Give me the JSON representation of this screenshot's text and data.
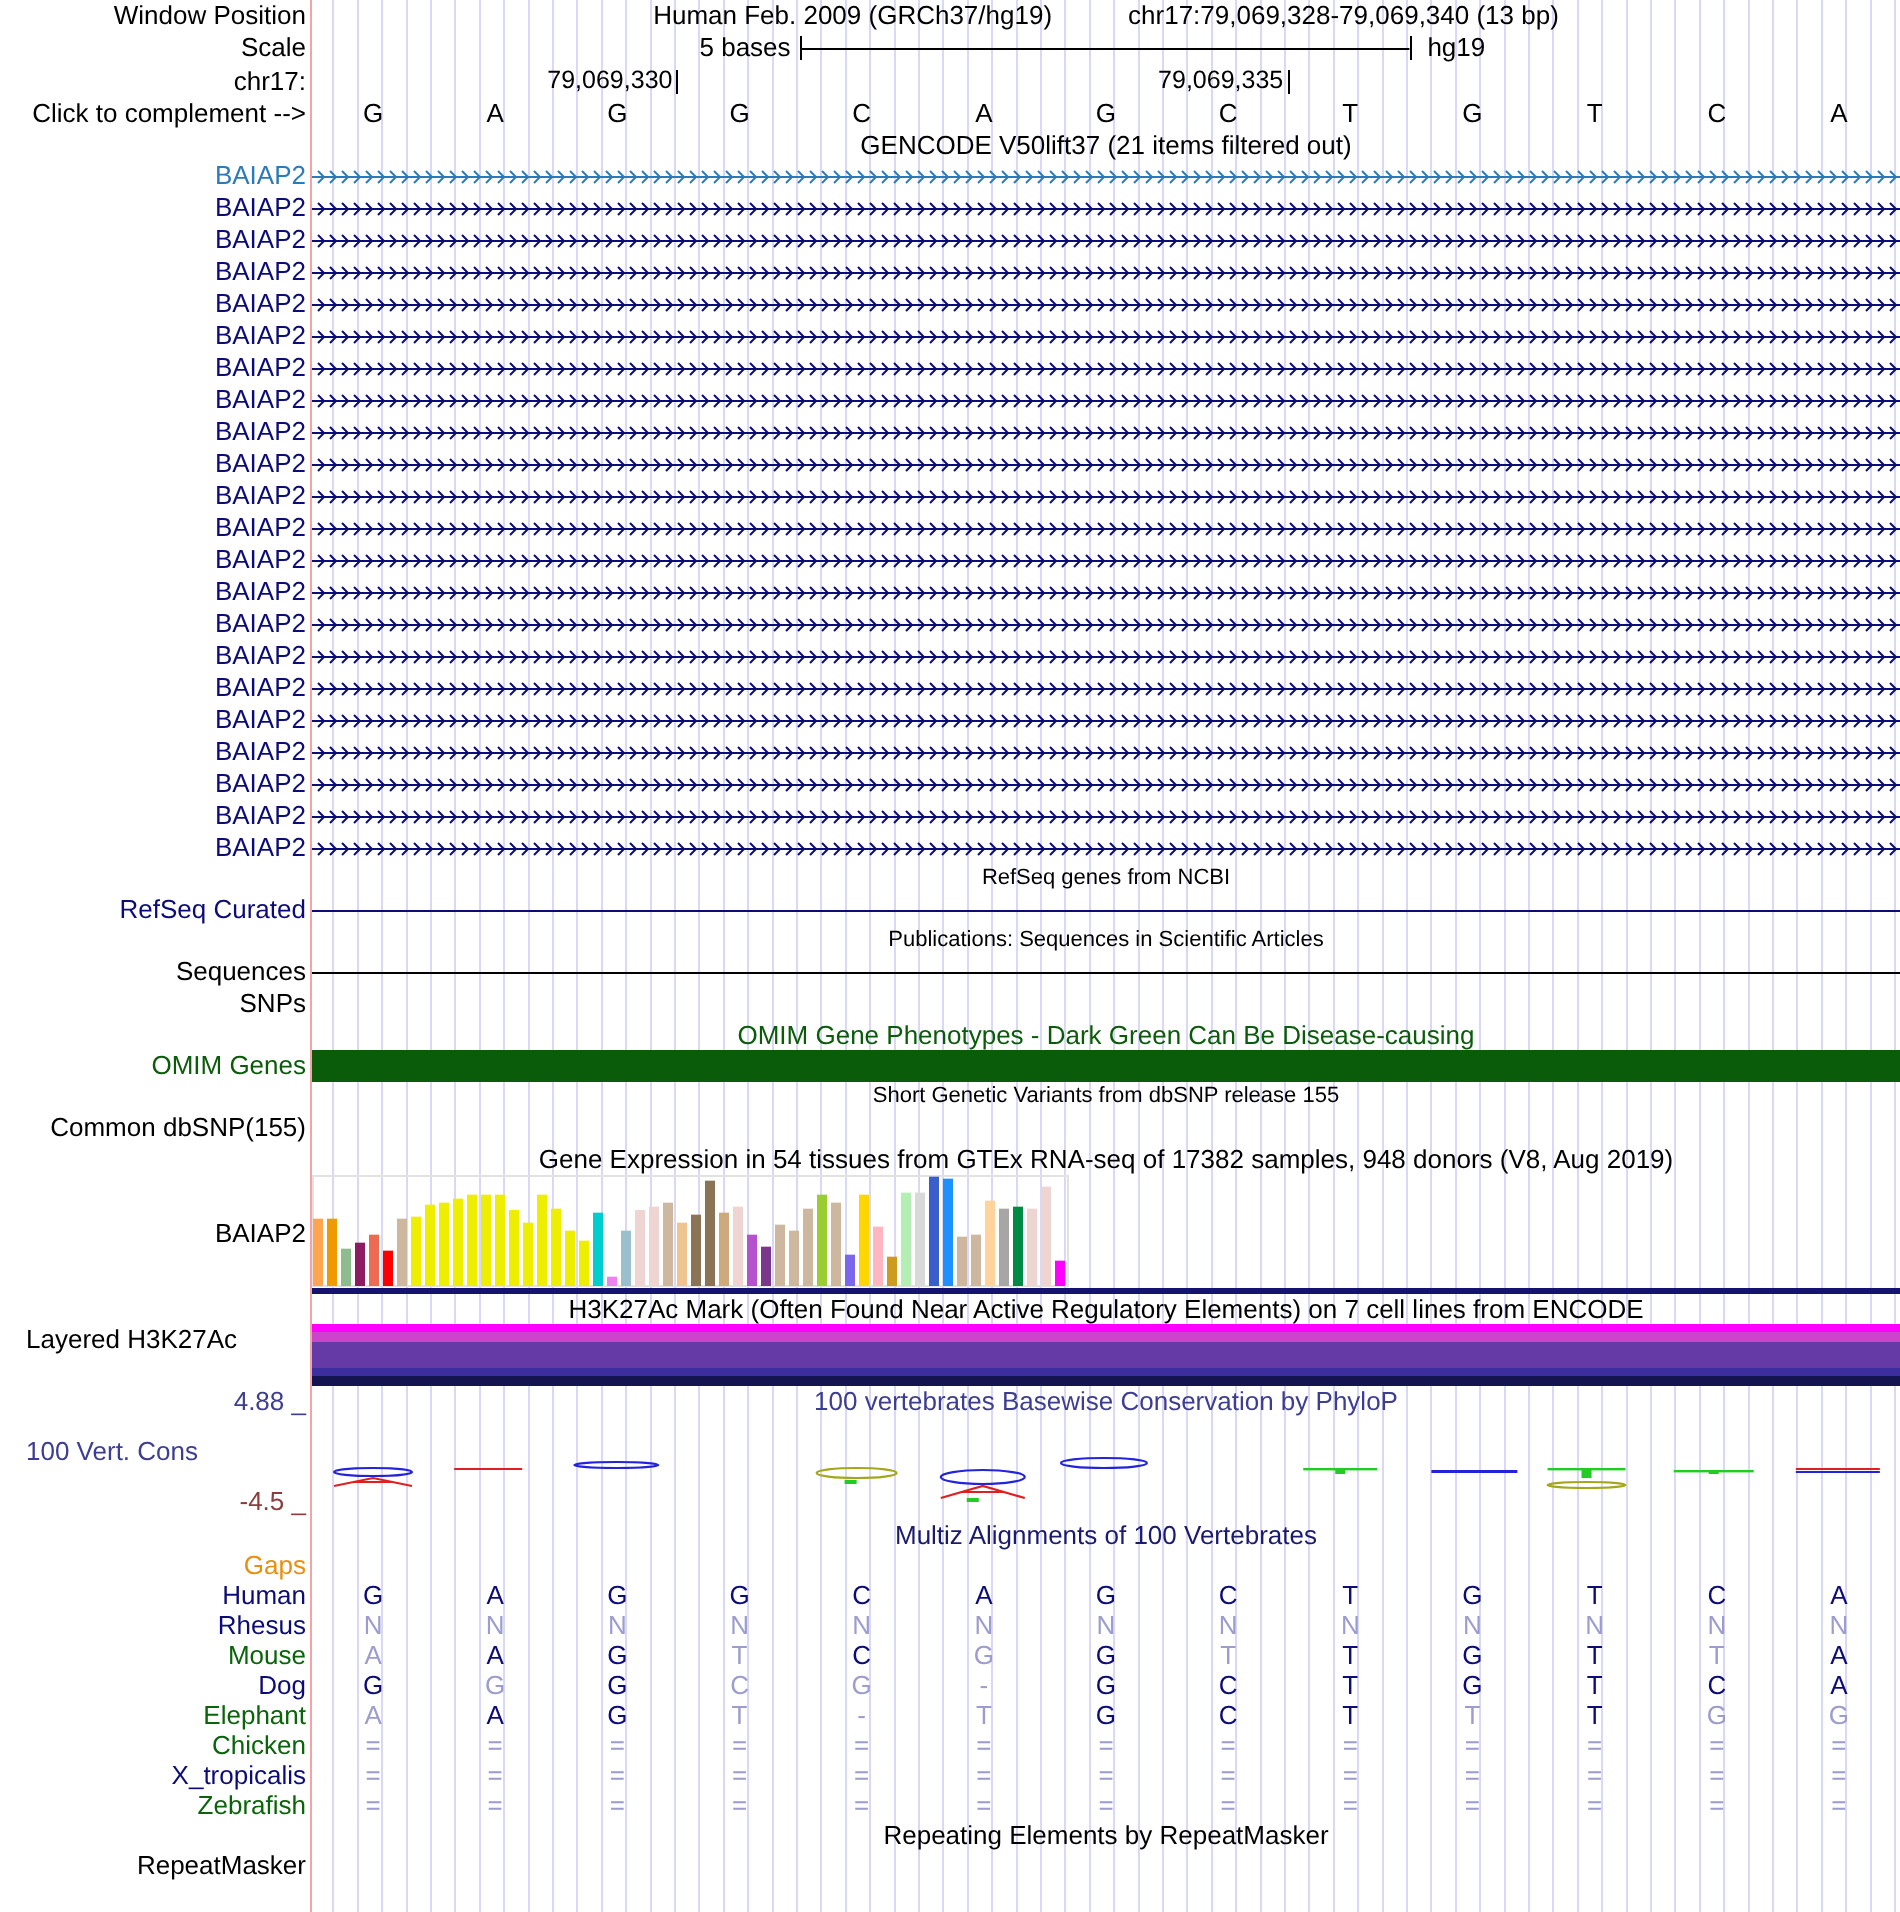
{
  "header": {
    "position": {
      "label": "Window Position",
      "assembly": "Human Feb. 2009 (GRCh37/hg19)",
      "range": "chr17:79,069,328-79,069,340 (13 bp)"
    },
    "scale": {
      "label": "Scale",
      "length": "5 bases",
      "assembly": "hg19"
    },
    "ruler": {
      "label": "chr17:",
      "ticks": [
        "79,069,330",
        "79,069,335"
      ]
    },
    "sequence": {
      "label": "Click to complement -->",
      "bases": [
        "G",
        "A",
        "G",
        "G",
        "C",
        "A",
        "G",
        "C",
        "T",
        "G",
        "T",
        "C",
        "A"
      ]
    }
  },
  "tracks": [
    {
      "dense": false,
      "title": "GENCODE V50lift37 (21 items filtered out)",
      "color": "#000000",
      "rows": [
        {
          "kind": "gene",
          "label": "BAIAP2",
          "color": "#2b7bba"
        },
        {
          "kind": "gene",
          "label": "BAIAP2",
          "color": "#0c0c78"
        },
        {
          "kind": "gene",
          "label": "BAIAP2",
          "color": "#0c0c78"
        },
        {
          "kind": "gene",
          "label": "BAIAP2",
          "color": "#0c0c78"
        },
        {
          "kind": "gene",
          "label": "BAIAP2",
          "color": "#0c0c78"
        },
        {
          "kind": "gene",
          "label": "BAIAP2",
          "color": "#0c0c78"
        },
        {
          "kind": "gene",
          "label": "BAIAP2",
          "color": "#0c0c78"
        },
        {
          "kind": "gene",
          "label": "BAIAP2",
          "color": "#0c0c78"
        },
        {
          "kind": "gene",
          "label": "BAIAP2",
          "color": "#0c0c78"
        },
        {
          "kind": "gene",
          "label": "BAIAP2",
          "color": "#0c0c78"
        },
        {
          "kind": "gene",
          "label": "BAIAP2",
          "color": "#0c0c78"
        },
        {
          "kind": "gene",
          "label": "BAIAP2",
          "color": "#0c0c78"
        },
        {
          "kind": "gene",
          "label": "BAIAP2",
          "color": "#0c0c78"
        },
        {
          "kind": "gene",
          "label": "BAIAP2",
          "color": "#0c0c78"
        },
        {
          "kind": "gene",
          "label": "BAIAP2",
          "color": "#0c0c78"
        },
        {
          "kind": "gene",
          "label": "BAIAP2",
          "color": "#0c0c78"
        },
        {
          "kind": "gene",
          "label": "BAIAP2",
          "color": "#0c0c78"
        },
        {
          "kind": "gene",
          "label": "BAIAP2",
          "color": "#0c0c78"
        },
        {
          "kind": "gene",
          "label": "BAIAP2",
          "color": "#0c0c78"
        },
        {
          "kind": "gene",
          "label": "BAIAP2",
          "color": "#0c0c78"
        },
        {
          "kind": "gene",
          "label": "BAIAP2",
          "color": "#0c0c78"
        },
        {
          "kind": "gene",
          "label": "BAIAP2",
          "color": "#0c0c78"
        }
      ]
    },
    {
      "dense": true,
      "title": "RefSeq genes from NCBI",
      "color": "#000000",
      "rows": [
        {
          "kind": "line",
          "label": "RefSeq Curated",
          "color": "#0c0c78"
        }
      ]
    },
    {
      "dense": true,
      "title": "Publications: Sequences in Scientific Articles",
      "color": "#000000",
      "rows": [
        {
          "kind": "line",
          "label": "Sequences",
          "color": "#000000"
        },
        {
          "kind": "empty",
          "label": "SNPs",
          "color": "#000000"
        }
      ]
    },
    {
      "dense": false,
      "title": "OMIM Gene Phenotypes - Dark Green Can Be Disease-causing",
      "color": "#0a5c0a",
      "rows": [
        {
          "kind": "bar",
          "label": "OMIM Genes",
          "color": "#0a5c0a"
        }
      ]
    },
    {
      "dense": true,
      "title": "Short Genetic Variants from dbSNP release 155",
      "color": "#000000",
      "rows": [
        {
          "kind": "empty",
          "label": "Common dbSNP(155)",
          "color": "#000000"
        }
      ]
    },
    {
      "dense": false,
      "title": "Gene Expression in 54 tissues from GTEx RNA-seq of 17382 samples, 948 donors (V8, Aug 2019)",
      "color": "#000000",
      "rows": [
        {
          "kind": "barchart",
          "label": "BAIAP2",
          "color": "#000000"
        }
      ]
    },
    {
      "dense": false,
      "title": "H3K27Ac Mark (Often Found Near Active Regulatory Elements) on 7 cell lines from ENCODE",
      "color": "#000000",
      "rows": [
        {
          "kind": "band",
          "label": "Layered H3K27Ac",
          "color": "#000000"
        }
      ]
    },
    {
      "dense": false,
      "title": "100 vertebrates Basewise Conservation by PhyloP",
      "color": "#3d3d91",
      "axis_max": "4.88 _",
      "rows": [
        {
          "kind": "logo",
          "label": "100 Vert. Cons",
          "color": "#3d3d91",
          "axis_min": "-4.5 _"
        }
      ]
    },
    {
      "dense": false,
      "title": "Multiz Alignments of 100 Vertebrates",
      "color": "#1a1a6e",
      "rows": [
        {
          "kind": "empty",
          "label": "Gaps",
          "color": "#e8900c"
        },
        {
          "kind": "alignment",
          "label": "Human",
          "color": "#0c0c78",
          "cells": [
            {
              "text": "G",
              "match": true
            },
            {
              "text": "A",
              "match": true
            },
            {
              "text": "G",
              "match": true
            },
            {
              "text": "G",
              "match": true
            },
            {
              "text": "C",
              "match": true
            },
            {
              "text": "A",
              "match": true
            },
            {
              "text": "G",
              "match": true
            },
            {
              "text": "C",
              "match": true
            },
            {
              "text": "T",
              "match": true
            },
            {
              "text": "G",
              "match": true
            },
            {
              "text": "T",
              "match": true
            },
            {
              "text": "C",
              "match": true
            },
            {
              "text": "A",
              "match": true
            }
          ]
        },
        {
          "kind": "alignment",
          "label": "Rhesus",
          "color": "#0c0c78",
          "cells": [
            {
              "text": "N",
              "match": false
            },
            {
              "text": "N",
              "match": false
            },
            {
              "text": "N",
              "match": false
            },
            {
              "text": "N",
              "match": false
            },
            {
              "text": "N",
              "match": false
            },
            {
              "text": "N",
              "match": false
            },
            {
              "text": "N",
              "match": false
            },
            {
              "text": "N",
              "match": false
            },
            {
              "text": "N",
              "match": false
            },
            {
              "text": "N",
              "match": false
            },
            {
              "text": "N",
              "match": false
            },
            {
              "text": "N",
              "match": false
            },
            {
              "text": "N",
              "match": false
            }
          ]
        },
        {
          "kind": "alignment",
          "label": "Mouse",
          "color": "#0a640a",
          "cells": [
            {
              "text": "A",
              "match": false
            },
            {
              "text": "A",
              "match": true
            },
            {
              "text": "G",
              "match": true
            },
            {
              "text": "T",
              "match": false
            },
            {
              "text": "C",
              "match": true
            },
            {
              "text": "G",
              "match": false
            },
            {
              "text": "G",
              "match": true
            },
            {
              "text": "T",
              "match": false
            },
            {
              "text": "T",
              "match": true
            },
            {
              "text": "G",
              "match": true
            },
            {
              "text": "T",
              "match": true
            },
            {
              "text": "T",
              "match": false
            },
            {
              "text": "A",
              "match": true
            }
          ]
        },
        {
          "kind": "alignment",
          "label": "Dog",
          "color": "#0c0c78",
          "cells": [
            {
              "text": "G",
              "match": true
            },
            {
              "text": "G",
              "match": false
            },
            {
              "text": "G",
              "match": true
            },
            {
              "text": "C",
              "match": false
            },
            {
              "text": "G",
              "match": false
            },
            {
              "text": "-",
              "match": false
            },
            {
              "text": "G",
              "match": true
            },
            {
              "text": "C",
              "match": true
            },
            {
              "text": "T",
              "match": true
            },
            {
              "text": "G",
              "match": true
            },
            {
              "text": "T",
              "match": true
            },
            {
              "text": "C",
              "match": true
            },
            {
              "text": "A",
              "match": true
            }
          ]
        },
        {
          "kind": "alignment",
          "label": "Elephant",
          "color": "#0a640a",
          "cells": [
            {
              "text": "A",
              "match": false
            },
            {
              "text": "A",
              "match": true
            },
            {
              "text": "G",
              "match": true
            },
            {
              "text": "T",
              "match": false
            },
            {
              "text": "-",
              "match": false
            },
            {
              "text": "T",
              "match": false
            },
            {
              "text": "G",
              "match": true
            },
            {
              "text": "C",
              "match": true
            },
            {
              "text": "T",
              "match": true
            },
            {
              "text": "T",
              "match": false
            },
            {
              "text": "T",
              "match": true
            },
            {
              "text": "G",
              "match": false
            },
            {
              "text": "G",
              "match": false
            }
          ]
        },
        {
          "kind": "alignment",
          "label": "Chicken",
          "color": "#0a640a",
          "cells": [
            {
              "text": "=",
              "match": false
            },
            {
              "text": "=",
              "match": false
            },
            {
              "text": "=",
              "match": false
            },
            {
              "text": "=",
              "match": false
            },
            {
              "text": "=",
              "match": false
            },
            {
              "text": "=",
              "match": false
            },
            {
              "text": "=",
              "match": false
            },
            {
              "text": "=",
              "match": false
            },
            {
              "text": "=",
              "match": false
            },
            {
              "text": "=",
              "match": false
            },
            {
              "text": "=",
              "match": false
            },
            {
              "text": "=",
              "match": false
            },
            {
              "text": "=",
              "match": false
            }
          ]
        },
        {
          "kind": "alignment",
          "label": "X_tropicalis",
          "color": "#0c0c78",
          "cells": [
            {
              "text": "=",
              "match": false
            },
            {
              "text": "=",
              "match": false
            },
            {
              "text": "=",
              "match": false
            },
            {
              "text": "=",
              "match": false
            },
            {
              "text": "=",
              "match": false
            },
            {
              "text": "=",
              "match": false
            },
            {
              "text": "=",
              "match": false
            },
            {
              "text": "=",
              "match": false
            },
            {
              "text": "=",
              "match": false
            },
            {
              "text": "=",
              "match": false
            },
            {
              "text": "=",
              "match": false
            },
            {
              "text": "=",
              "match": false
            },
            {
              "text": "=",
              "match": false
            }
          ]
        },
        {
          "kind": "alignment",
          "label": "Zebrafish",
          "color": "#0a640a",
          "cells": [
            {
              "text": "=",
              "match": false
            },
            {
              "text": "=",
              "match": false
            },
            {
              "text": "=",
              "match": false
            },
            {
              "text": "=",
              "match": false
            },
            {
              "text": "=",
              "match": false
            },
            {
              "text": "=",
              "match": false
            },
            {
              "text": "=",
              "match": false
            },
            {
              "text": "=",
              "match": false
            },
            {
              "text": "=",
              "match": false
            },
            {
              "text": "=",
              "match": false
            },
            {
              "text": "=",
              "match": false
            },
            {
              "text": "=",
              "match": false
            },
            {
              "text": "=",
              "match": false
            }
          ]
        }
      ]
    },
    {
      "dense": false,
      "title": "Repeating Elements by RepeatMasker",
      "color": "#000000",
      "rows": [
        {
          "kind": "empty",
          "label": "RepeatMasker",
          "color": "#000000"
        }
      ]
    }
  ]
}
